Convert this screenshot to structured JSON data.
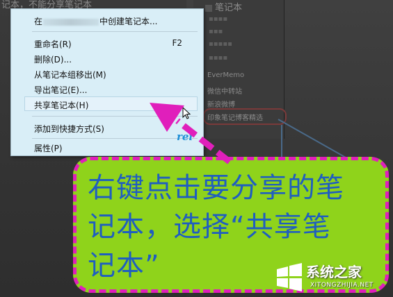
{
  "background": {
    "top_text": "记本，不能分享笔记本",
    "notebook_panel_title": "笔记本",
    "notebook_items": [
      {
        "label": "EverMemo"
      },
      {
        "label": "微信中转站"
      },
      {
        "label": "新浪微博"
      },
      {
        "label": "印象笔记博客精选"
      }
    ]
  },
  "context_menu": {
    "items": [
      {
        "label_prefix": "在",
        "label_suffix": "中创建笔记本...",
        "shortcut": ""
      },
      {
        "label": "重命名(R)",
        "shortcut": "F2"
      },
      {
        "label": "删除(D)...",
        "shortcut": ""
      },
      {
        "label": "从笔记本组移出(M)",
        "shortcut": ""
      },
      {
        "label": "导出笔记(E)...",
        "shortcut": ""
      },
      {
        "label": "共享笔记本(H)",
        "shortcut": ""
      },
      {
        "label": "添加到快捷方式(S)",
        "shortcut": ""
      },
      {
        "label": "属性(P)",
        "shortcut": ""
      }
    ],
    "logo": "rei"
  },
  "callout": {
    "line1": "右键点击要分享的笔",
    "line2": "记本，选择“共享笔",
    "line3": "记本”"
  },
  "watermark": {
    "title": "系统之家",
    "url": "XITONGZHIJIA.NET"
  },
  "colors": {
    "callout_fill": "#8fd31b",
    "callout_border": "#e01fbb",
    "callout_text": "#1f5ec0",
    "menu_bg": "#d9eef7"
  }
}
